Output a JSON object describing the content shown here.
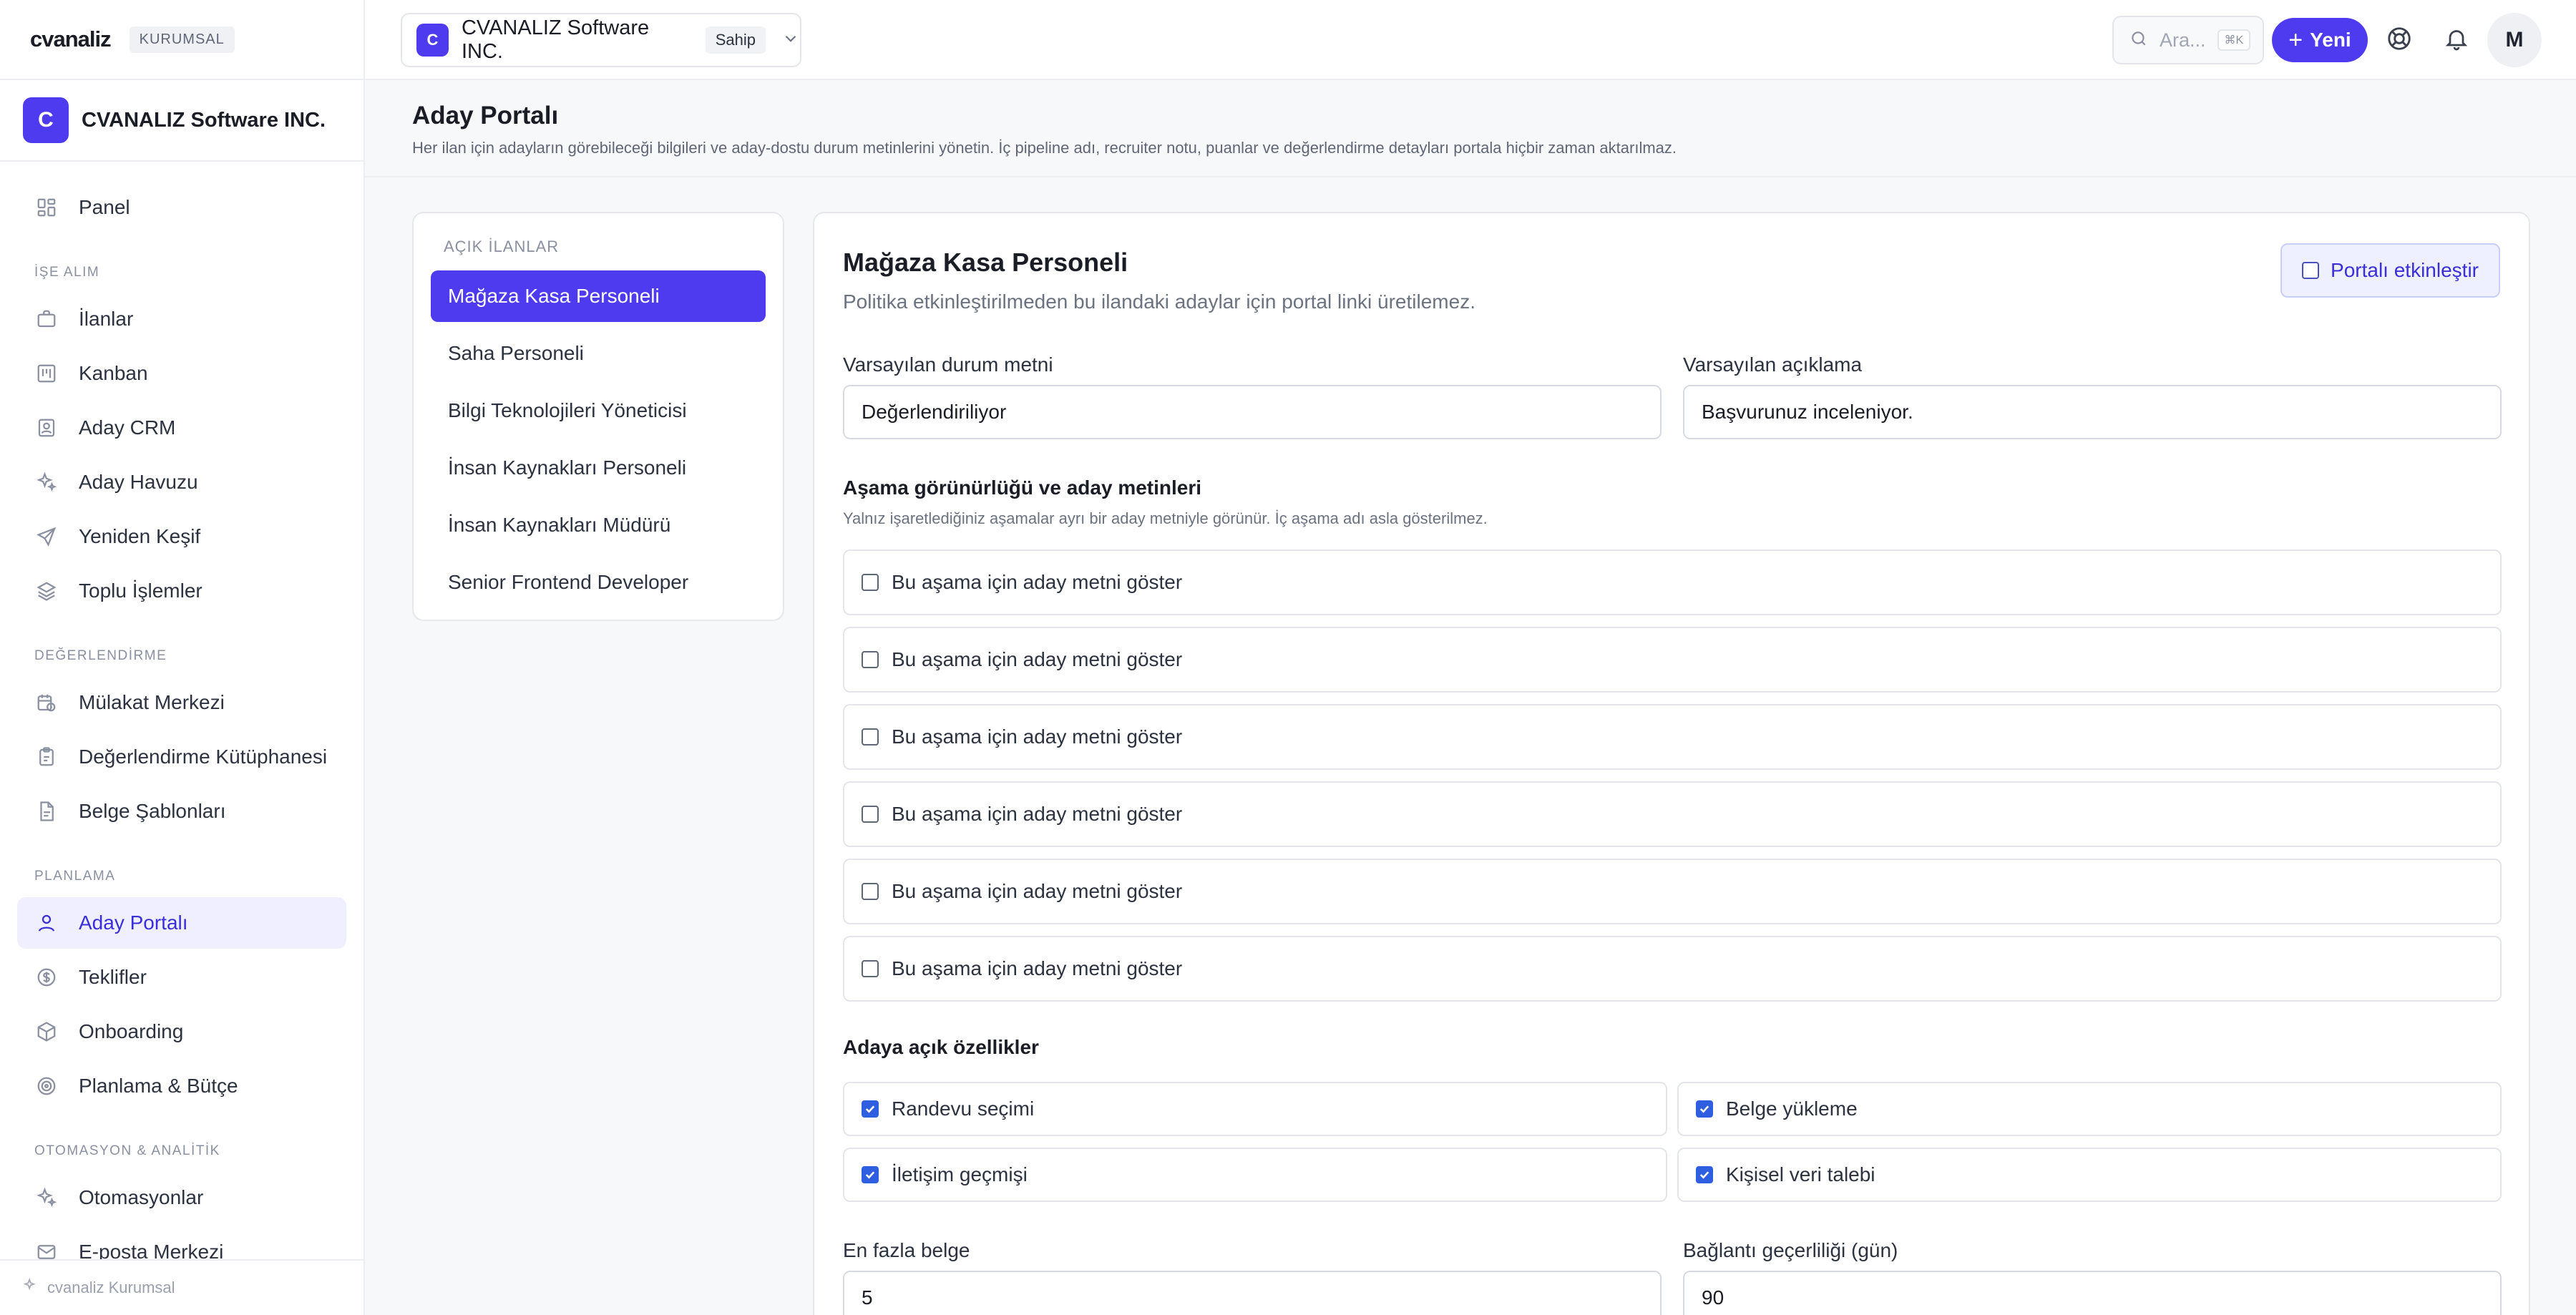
{
  "brand": {
    "logo": "cvanaliz",
    "badge": "KURUMSAL"
  },
  "org": {
    "initial": "C",
    "name": "CVANALIZ Software INC.",
    "role": "Sahip"
  },
  "nav": {
    "panel": "Panel",
    "sections": {
      "recruitment": "İŞE ALIM",
      "assessment": "DEĞERLENDİRME",
      "planning": "PLANLAMA",
      "automation": "OTOMASYON & ANALİTİK"
    },
    "items": {
      "ilanlar": "İlanlar",
      "kanban": "Kanban",
      "aday_crm": "Aday CRM",
      "aday_havuzu": "Aday Havuzu",
      "yeniden_kesif": "Yeniden Keşif",
      "toplu_islemler": "Toplu İşlemler",
      "mulakat": "Mülakat Merkezi",
      "kutuphane": "Değerlendirme Kütüphanesi",
      "belge": "Belge Şablonları",
      "aday_portali": "Aday Portalı",
      "teklifler": "Teklifler",
      "onboarding": "Onboarding",
      "planlama_butce": "Planlama & Bütçe",
      "otomasyonlar": "Otomasyonlar",
      "eposta": "E-posta Merkezi"
    },
    "footer": "cvanaliz Kurumsal"
  },
  "topbar": {
    "search_placeholder": "Ara...",
    "search_shortcut": "⌘K",
    "new_button": "Yeni",
    "user_initial": "M"
  },
  "page": {
    "title": "Aday Portalı",
    "description": "Her ilan için adayların görebileceği bilgileri ve aday-dostu durum metinlerini yönetin. İç pipeline adı, recruiter notu, puanlar ve değerlendirme detayları portala hiçbir zaman aktarılmaz."
  },
  "jobs": {
    "title": "AÇIK İLANLAR",
    "items": [
      "Mağaza Kasa Personeli",
      "Saha Personeli",
      "Bilgi Teknolojileri Yöneticisi",
      "İnsan Kaynakları Personeli",
      "İnsan Kaynakları Müdürü",
      "Senior Frontend Developer"
    ]
  },
  "detail": {
    "title": "Mağaza Kasa Personeli",
    "subtitle": "Politika etkinleştirilmeden bu ilandaki adaylar için portal linki üretilemez.",
    "enable_portal": "Portalı etkinleştir",
    "default_status_label": "Varsayılan durum metni",
    "default_status_value": "Değerlendiriliyor",
    "default_desc_label": "Varsayılan açıklama",
    "default_desc_value": "Başvurunuz inceleniyor.",
    "stage_title": "Aşama görünürlüğü ve aday metinleri",
    "stage_sub": "Yalnız işaretlediğiniz aşamalar ayrı bir aday metniyle görünür. İç aşama adı asla gösterilmez.",
    "stage_option": "Bu aşama için aday metni göster",
    "features_title": "Adaya açık özellikler",
    "features": {
      "randevu": "Randevu seçimi",
      "belge_yukleme": "Belge yükleme",
      "iletisim": "İletişim geçmişi",
      "kisisel_veri": "Kişisel veri talebi"
    },
    "max_docs_label": "En fazla belge",
    "max_docs_value": "5",
    "link_validity_label": "Bağlantı geçerliliği (gün)",
    "link_validity_value": "90"
  },
  "colors": {
    "accent": "#4f3bef",
    "checkbox": "#2f5fe0"
  }
}
